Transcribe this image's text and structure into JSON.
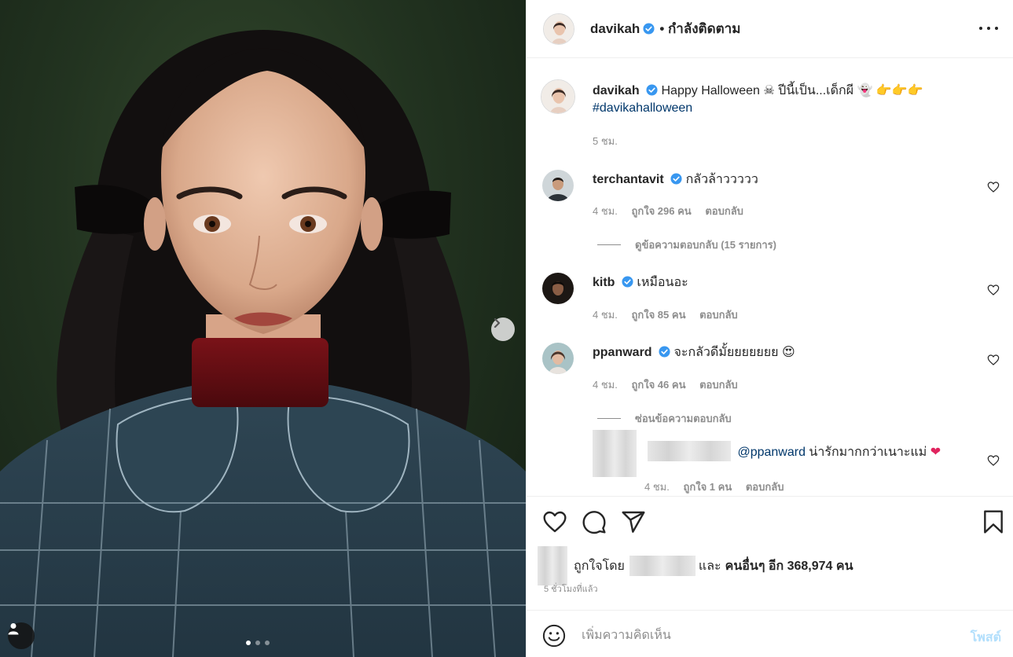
{
  "post": {
    "author": "davikah",
    "follow_status": "กำลังติดตาม",
    "caption_text": "Happy Halloween",
    "caption_rest": "ปีนี้เป็น...เด็กผี",
    "hashtag": "#davikahalloween",
    "caption_time": "5 ชม.",
    "carousel_total": 3,
    "carousel_index": 1
  },
  "comments": [
    {
      "user": "terchantavit",
      "text": "กลัวล้าววววว",
      "time": "4 ชม.",
      "likes": "ถูกใจ 296 คน",
      "reply": "ตอบกลับ",
      "replies_toggle": "ดูข้อความตอบกลับ (15 รายการ)"
    },
    {
      "user": "kitb",
      "text": "เหมือนอะ",
      "time": "4 ชม.",
      "likes": "ถูกใจ 85 คน",
      "reply": "ตอบกลับ"
    },
    {
      "user": "ppanward",
      "text": "จะกลัวดีมั้ยยยยยยย",
      "time": "4 ชม.",
      "likes": "ถูกใจ 46 คน",
      "reply": "ตอบกลับ",
      "replies_toggle": "ซ่อนข้อความตอบกลับ"
    }
  ],
  "reply": {
    "mention": "@ppanward",
    "text": "น่ารักมากกว่าเนาะแม่",
    "time": "4 ชม.",
    "likes": "ถูกใจ 1 คน",
    "reply": "ตอบกลับ"
  },
  "likes_summary": {
    "prefix": "ถูกใจโดย",
    "and": "และ",
    "others": "คนอื่นๆ อีก 368,974 คน"
  },
  "time_ago": "5 ชั่วโมงที่แล้ว",
  "comment_box": {
    "placeholder": "เพิ่มความคิดเห็น",
    "post_label": "โพสต์"
  },
  "icons": {
    "header_more": "more-horizontal-icon",
    "like": "heart-icon",
    "comment": "comment-bubble-icon",
    "share": "paper-plane-icon",
    "save": "bookmark-icon",
    "emoji": "smiley-icon",
    "next": "chevron-right-icon",
    "tag": "user-tag-icon"
  },
  "colors": {
    "verified": "#3897f0",
    "link": "#00376b",
    "muted": "#8e8e8e",
    "post_disabled": "#b2dffc"
  }
}
